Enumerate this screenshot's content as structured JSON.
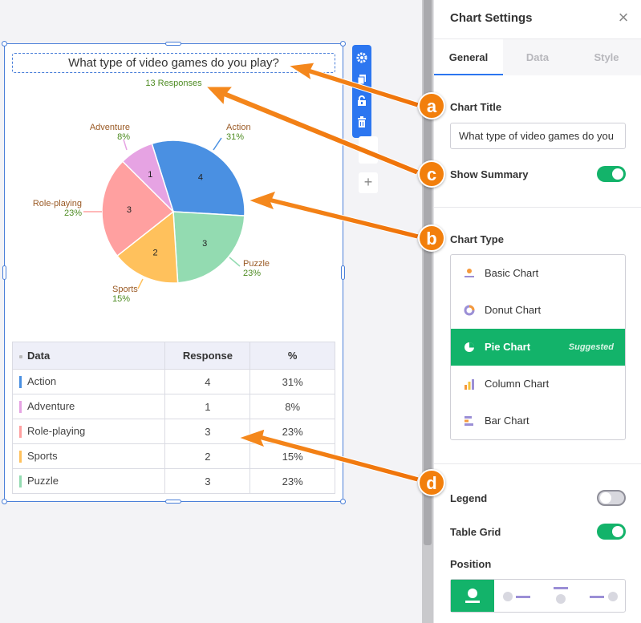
{
  "chart": {
    "title": "What type of video games do you play?",
    "summary": "13 Responses"
  },
  "chart_data": {
    "type": "pie",
    "categories": [
      "Action",
      "Adventure",
      "Role-playing",
      "Sports",
      "Puzzle"
    ],
    "values": [
      4,
      1,
      3,
      2,
      3
    ],
    "percents": [
      "31%",
      "8%",
      "23%",
      "15%",
      "23%"
    ],
    "colors": [
      "#4a90e2",
      "#e6a3e3",
      "#ffa0a0",
      "#ffc15c",
      "#93dbb1"
    ],
    "title": "What type of video games do you play?",
    "legend": "off"
  },
  "table": {
    "headers": [
      "Data",
      "Response",
      "%"
    ],
    "rows": [
      {
        "label": "Action",
        "response": "4",
        "percent": "31%"
      },
      {
        "label": "Adventure",
        "response": "1",
        "percent": "8%"
      },
      {
        "label": "Role-playing",
        "response": "3",
        "percent": "23%"
      },
      {
        "label": "Sports",
        "response": "2",
        "percent": "15%"
      },
      {
        "label": "Puzzle",
        "response": "3",
        "percent": "23%"
      }
    ]
  },
  "toolbar": {
    "icons": [
      "gear-icon",
      "copy-icon",
      "lock-icon",
      "trash-icon",
      "plus-icon"
    ],
    "add_label": "+"
  },
  "panel": {
    "title": "Chart Settings",
    "close_label": "×",
    "tabs": [
      "General",
      "Data",
      "Style"
    ],
    "active_tab": "General",
    "chart_title_label": "Chart Title",
    "chart_title_value": "What type of video games do you play?",
    "show_summary_label": "Show Summary",
    "show_summary_on": true,
    "chart_type_label": "Chart Type",
    "chart_types": [
      {
        "label": "Basic Chart",
        "icon": "basic-chart-icon"
      },
      {
        "label": "Donut Chart",
        "icon": "donut-chart-icon"
      },
      {
        "label": "Pie Chart",
        "icon": "pie-chart-icon"
      },
      {
        "label": "Column Chart",
        "icon": "column-chart-icon"
      },
      {
        "label": "Bar Chart",
        "icon": "bar-chart-icon"
      }
    ],
    "selected_chart_type": "Pie Chart",
    "suggested_label": "Suggested",
    "legend_label": "Legend",
    "legend_on": false,
    "table_grid_label": "Table Grid",
    "table_grid_on": true,
    "position_label": "Position"
  },
  "callouts": [
    "a",
    "c",
    "b",
    "d"
  ],
  "colors": {
    "accent_blue": "#2c76f0",
    "accent_green": "#13b36a",
    "callout_orange": "#f27f0c"
  }
}
